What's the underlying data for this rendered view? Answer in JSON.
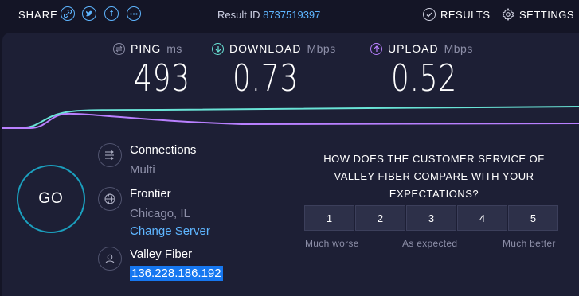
{
  "topbar": {
    "share_label": "SHARE",
    "share_icons": [
      "link-icon",
      "twitter-icon",
      "facebook-icon",
      "more-icon"
    ],
    "result_label": "Result ID",
    "result_id": "8737519397",
    "results_label": "RESULTS",
    "settings_label": "SETTINGS"
  },
  "metrics": {
    "ping": {
      "label": "PING",
      "unit": "ms",
      "value": "493",
      "color": "#8d8fa8"
    },
    "download": {
      "label": "DOWNLOAD",
      "unit": "Mbps",
      "value": "0.73",
      "color": "#69e3d6"
    },
    "upload": {
      "label": "UPLOAD",
      "unit": "Mbps",
      "value": "0.52",
      "color": "#b980ff"
    }
  },
  "go_label": "GO",
  "info": {
    "connections_title": "Connections",
    "connections_value": "Multi",
    "server_name": "Frontier",
    "server_location": "Chicago, IL",
    "change_server": "Change Server",
    "provider_name": "Valley Fiber",
    "ip_address": "136.228.186.192"
  },
  "survey": {
    "question": "HOW DOES THE CUSTOMER SERVICE OF VALLEY FIBER COMPARE WITH YOUR EXPECTATIONS?",
    "options": [
      "1",
      "2",
      "3",
      "4",
      "5"
    ],
    "label_low": "Much worse",
    "label_mid": "As expected",
    "label_high": "Much better"
  },
  "colors": {
    "accent_blue": "#5eb5ff",
    "download_line": "#69e3d6",
    "upload_line": "#b980ff",
    "go_ring": "#1b9fbe",
    "panel_bg": "#1d1f35",
    "page_bg": "#141526"
  }
}
